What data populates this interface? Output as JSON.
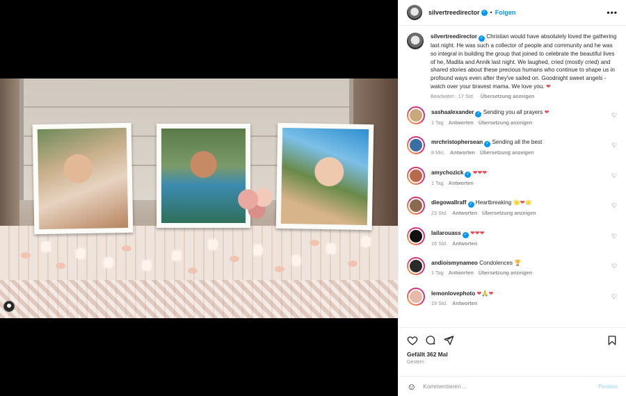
{
  "post": {
    "username": "silvertreedirector",
    "separator": "•",
    "follow_label": "Folgen",
    "more_label": "•••"
  },
  "caption": {
    "username": "silvertreedirector",
    "text": "Christian would have absolutely loved the gathering last night. He was such a collector of people and community and he was so integral in building the group that joined to celebrate the beautiful lives of he, Madita and Annik last night. We laughed, cried (mostly cried) and shared stories about these precious humans who continue to shape us in profound ways even after they've sailed on. Goodnight sweet angels - watch over your bravest mama. We love you.",
    "emoji": "❤",
    "edited": "Bearbeitet · 17 Std.",
    "translate": "Übersetzung anzeigen"
  },
  "comments": [
    {
      "user": "sashaalexander",
      "verified": true,
      "text": "Sending you all prayers",
      "emoji": "❤",
      "time": "1 Tag",
      "reply": "Antworten",
      "translate": "Übersetzung anzeigen",
      "avatar_color": "#c9a87a"
    },
    {
      "user": "mrchristophersean",
      "verified": true,
      "text": "Sending all the best",
      "emoji": "",
      "time": "8 Min.",
      "reply": "Antworten",
      "translate": "Übersetzung anzeigen",
      "avatar_color": "#3a6ea5"
    },
    {
      "user": "amychozick",
      "verified": true,
      "text": "",
      "emoji": "❤❤❤",
      "time": "1 Tag",
      "reply": "Antworten",
      "translate": "",
      "avatar_color": "#b86a4a"
    },
    {
      "user": "diegowallraff",
      "verified": true,
      "text": "Heartbreaking",
      "emoji": "🌟❤🌟",
      "time": "23 Std.",
      "reply": "Antworten",
      "translate": "Übersetzung anzeigen",
      "avatar_color": "#8a6a4a"
    },
    {
      "user": "lailarouass",
      "verified": true,
      "text": "",
      "emoji": "❤❤❤",
      "time": "16 Std.",
      "reply": "Antworten",
      "translate": "",
      "avatar_color": "#111111"
    },
    {
      "user": "andioismynameo",
      "verified": false,
      "text": "Condolences",
      "emoji": "🏆",
      "time": "1 Tag",
      "reply": "Antworten",
      "translate": "Übersetzung anzeigen",
      "avatar_color": "#2a2a2a"
    },
    {
      "user": "lemonlovephoto",
      "verified": false,
      "text": "",
      "emoji": "❤🙏❤",
      "time": "19 Std.",
      "reply": "Antworten",
      "translate": "",
      "avatar_color": "#e8b9a8"
    }
  ],
  "engagement": {
    "likes": "Gefällt 362 Mal",
    "date": "Gestern"
  },
  "composer": {
    "placeholder": "Kommentieren ...",
    "post_label": "Posten"
  },
  "colors": {
    "accent": "#0095f6",
    "heart": "#ed4956",
    "muted": "#8e8e8e"
  }
}
